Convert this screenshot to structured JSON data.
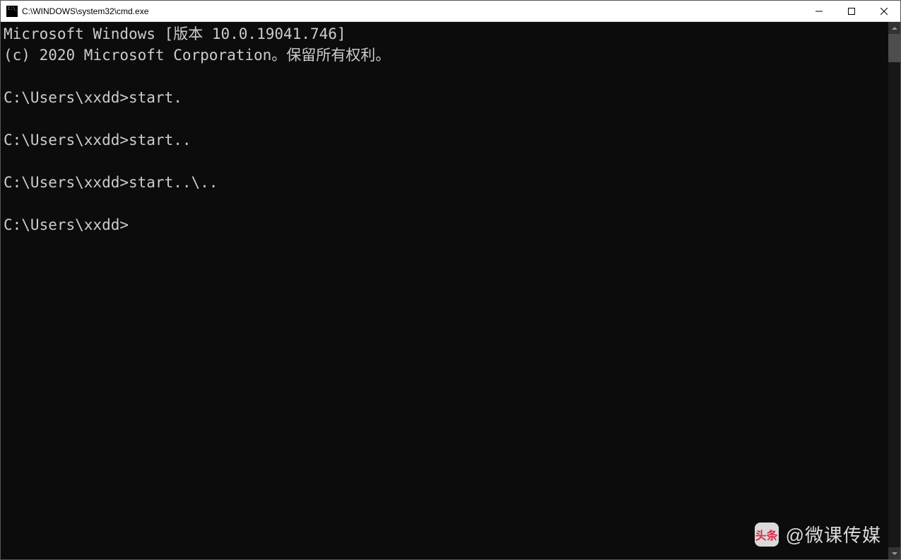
{
  "window": {
    "title": "C:\\WINDOWS\\system32\\cmd.exe"
  },
  "terminal": {
    "lines": [
      "Microsoft Windows [版本 10.0.19041.746]",
      "(c) 2020 Microsoft Corporation。保留所有权利。",
      "",
      "C:\\Users\\xxdd>start.",
      "",
      "C:\\Users\\xxdd>start..",
      "",
      "C:\\Users\\xxdd>start..\\..",
      "",
      "C:\\Users\\xxdd>"
    ]
  },
  "watermark": {
    "icon_text": "头条",
    "text": "@微课传媒"
  }
}
